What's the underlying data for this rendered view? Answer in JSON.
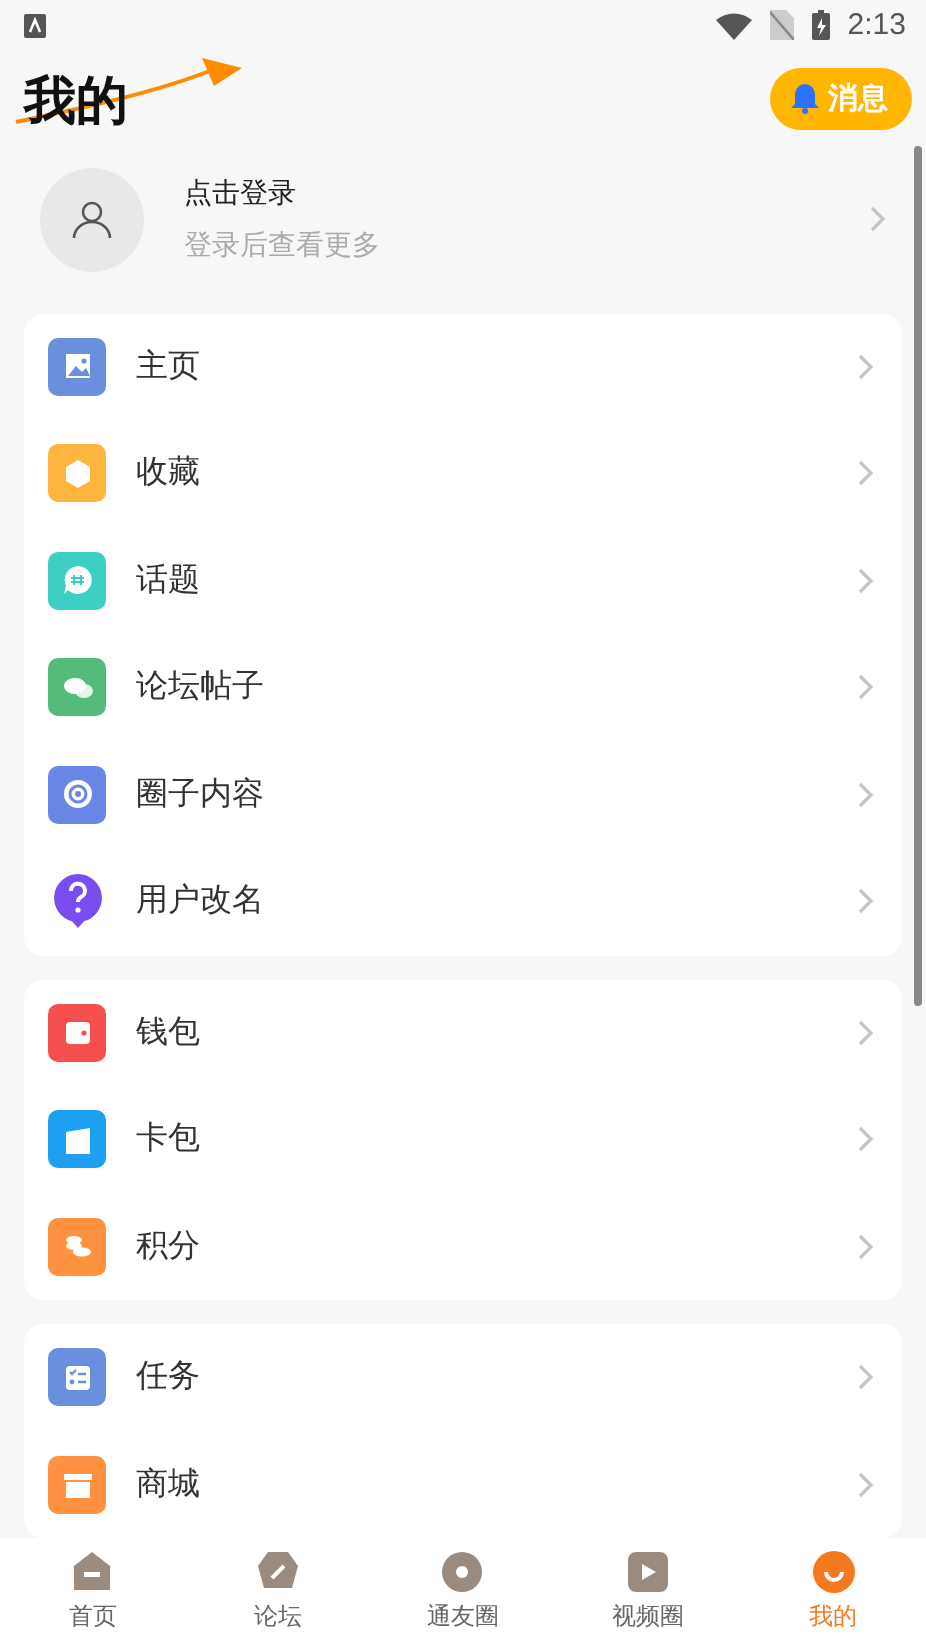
{
  "status_bar": {
    "time": "2:13"
  },
  "header": {
    "title": "我的",
    "message_button": "消息"
  },
  "login": {
    "title": "点击登录",
    "subtitle": "登录后查看更多"
  },
  "menu_groups": [
    {
      "items": [
        {
          "label": "主页",
          "color": "#6a8fdf"
        },
        {
          "label": "收藏",
          "color": "#ffb43f"
        },
        {
          "label": "话题",
          "color": "#3ecfc4"
        },
        {
          "label": "论坛帖子",
          "color": "#55bb7a"
        },
        {
          "label": "圈子内容",
          "color": "#6a86e4"
        },
        {
          "label": "用户改名",
          "color": "#7a4df0"
        }
      ]
    },
    {
      "items": [
        {
          "label": "钱包",
          "color": "#f5504f"
        },
        {
          "label": "卡包",
          "color": "#1e9ff2"
        },
        {
          "label": "积分",
          "color": "#ff9240"
        }
      ]
    },
    {
      "items": [
        {
          "label": "任务",
          "color": "#6a8fdf"
        },
        {
          "label": "商城",
          "color": "#ff9240"
        }
      ]
    }
  ],
  "tab_bar": [
    {
      "label": "首页",
      "selected": false
    },
    {
      "label": "论坛",
      "selected": false
    },
    {
      "label": "通友圈",
      "selected": false
    },
    {
      "label": "视频圈",
      "selected": false
    },
    {
      "label": "我的",
      "selected": true
    }
  ]
}
